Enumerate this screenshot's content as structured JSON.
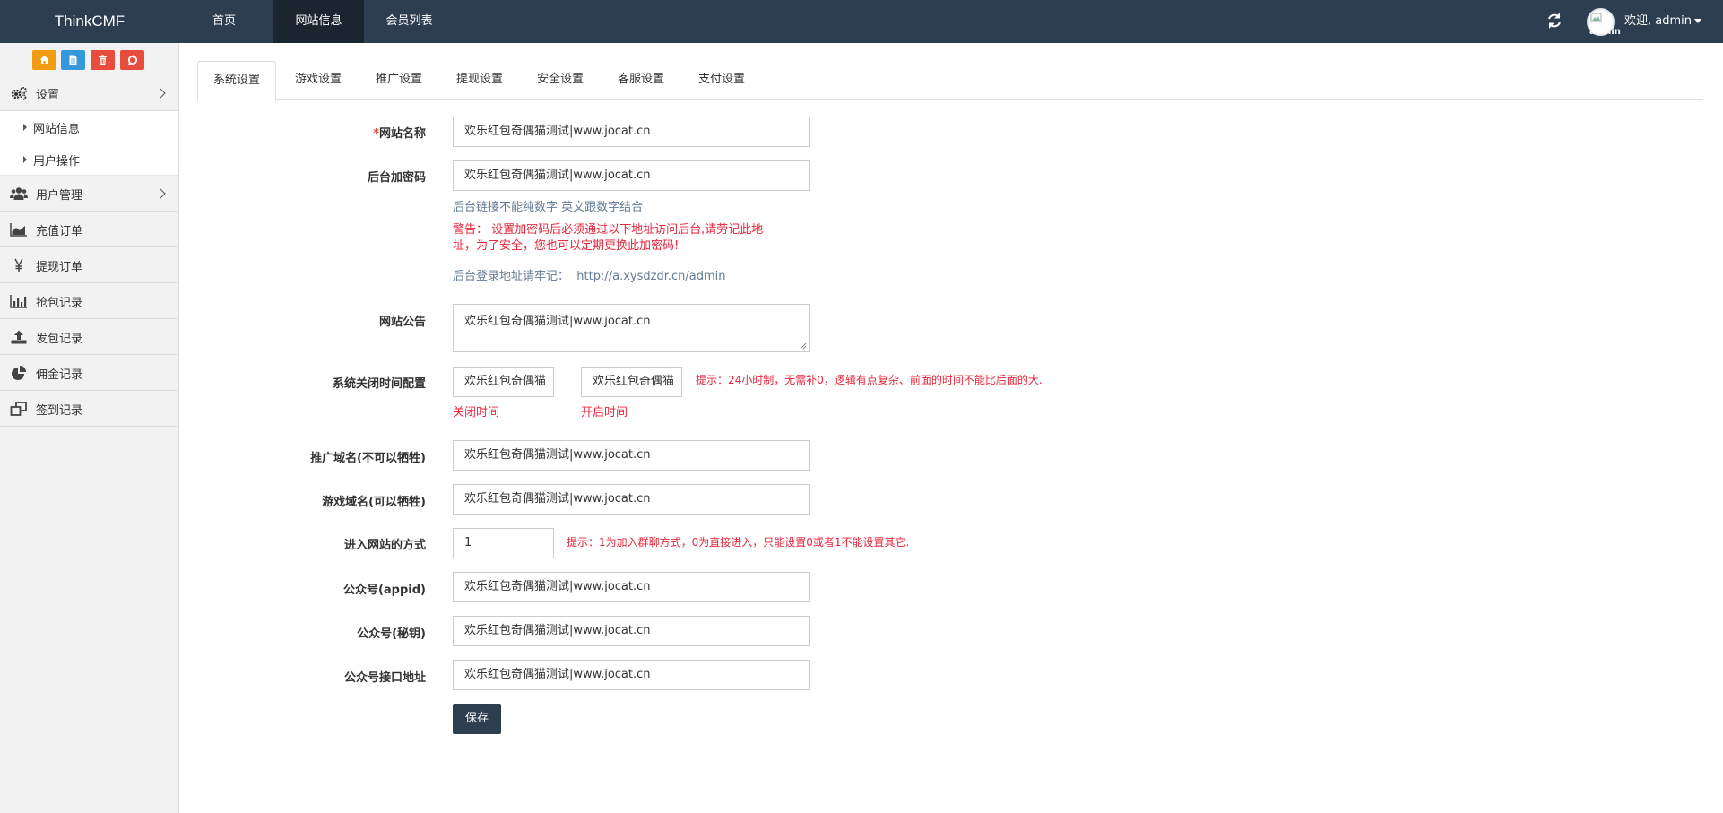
{
  "navbar": {
    "brand": "ThinkCMF",
    "items": [
      "首页",
      "网站信息",
      "会员列表"
    ],
    "active_index": 1,
    "avatar_alt": "admin",
    "welcome": "欢迎, admin"
  },
  "sidebar": {
    "quick_buttons": [
      {
        "icon": "home-icon",
        "color": "#f39c12"
      },
      {
        "icon": "file-icon",
        "color": "#3498db"
      },
      {
        "icon": "trash-icon",
        "color": "#e74c3c"
      },
      {
        "icon": "recycle-icon",
        "color": "#e74c3c"
      }
    ],
    "settings_label": "设置",
    "sub_items": [
      "网站信息",
      "用户操作"
    ],
    "menu_items": [
      {
        "label": "用户管理",
        "icon": "users-icon"
      },
      {
        "label": "充值订单",
        "icon": "area-chart-icon"
      },
      {
        "label": "提现订单",
        "icon": "yen-icon"
      },
      {
        "label": "抢包记录",
        "icon": "bar-chart-icon"
      },
      {
        "label": "发包记录",
        "icon": "upload-icon"
      },
      {
        "label": "佣金记录",
        "icon": "pie-chart-icon"
      },
      {
        "label": "签到记录",
        "icon": "clone-icon"
      }
    ]
  },
  "tabs": [
    "系统设置",
    "游戏设置",
    "推广设置",
    "提现设置",
    "安全设置",
    "客服设置",
    "支付设置"
  ],
  "form": {
    "site_name": {
      "label": "网站名称",
      "required_mark": "*",
      "value": "欢乐红包奇偶猫测试|www.jocat.cn"
    },
    "admin_password": {
      "label": "后台加密码",
      "value": "欢乐红包奇偶猫测试|www.jocat.cn",
      "help": "后台链接不能纯数字 英文跟数字结合",
      "warning_line1": "警告：  设置加密码后必须通过以下地址访问后台,请劳记此地",
      "warning_line2": "址，为了安全，您也可以定期更换此加密码!",
      "login_url_label": "后台登录地址请牢记：",
      "login_url": "http://a.xysdzdr.cn/admin"
    },
    "announcement": {
      "label": "网站公告",
      "value": "欢乐红包奇偶猫测试|www.jocat.cn"
    },
    "close_time": {
      "label": "系统关闭时间配置",
      "close_value": "欢乐红包奇偶猫",
      "open_value": "欢乐红包奇偶猫",
      "close_caption": "关闭时间",
      "open_caption": "开启时间",
      "tip": "提示：24小时制，无需补0，逻辑有点复杂、前面的时间不能比后面的大."
    },
    "promo_domain": {
      "label": "推广域名(不可以牺牲)",
      "value": "欢乐红包奇偶猫测试|www.jocat.cn"
    },
    "game_domain": {
      "label": "游戏域名(可以牺牲)",
      "value": "欢乐红包奇偶猫测试|www.jocat.cn"
    },
    "entry_mode": {
      "label": "进入网站的方式",
      "value": "1",
      "tip": "提示：1为加入群聊方式，0为直接进入，只能设置0或者1不能设置其它."
    },
    "appid": {
      "label": "公众号(appid)",
      "value": "欢乐红包奇偶猫测试|www.jocat.cn"
    },
    "secret": {
      "label": "公众号(秘钥)",
      "value": "欢乐红包奇偶猫测试|www.jocat.cn"
    },
    "api_url": {
      "label": "公众号接口地址",
      "value": "欢乐红包奇偶猫测试|www.jocat.cn"
    },
    "save_label": "保存"
  }
}
